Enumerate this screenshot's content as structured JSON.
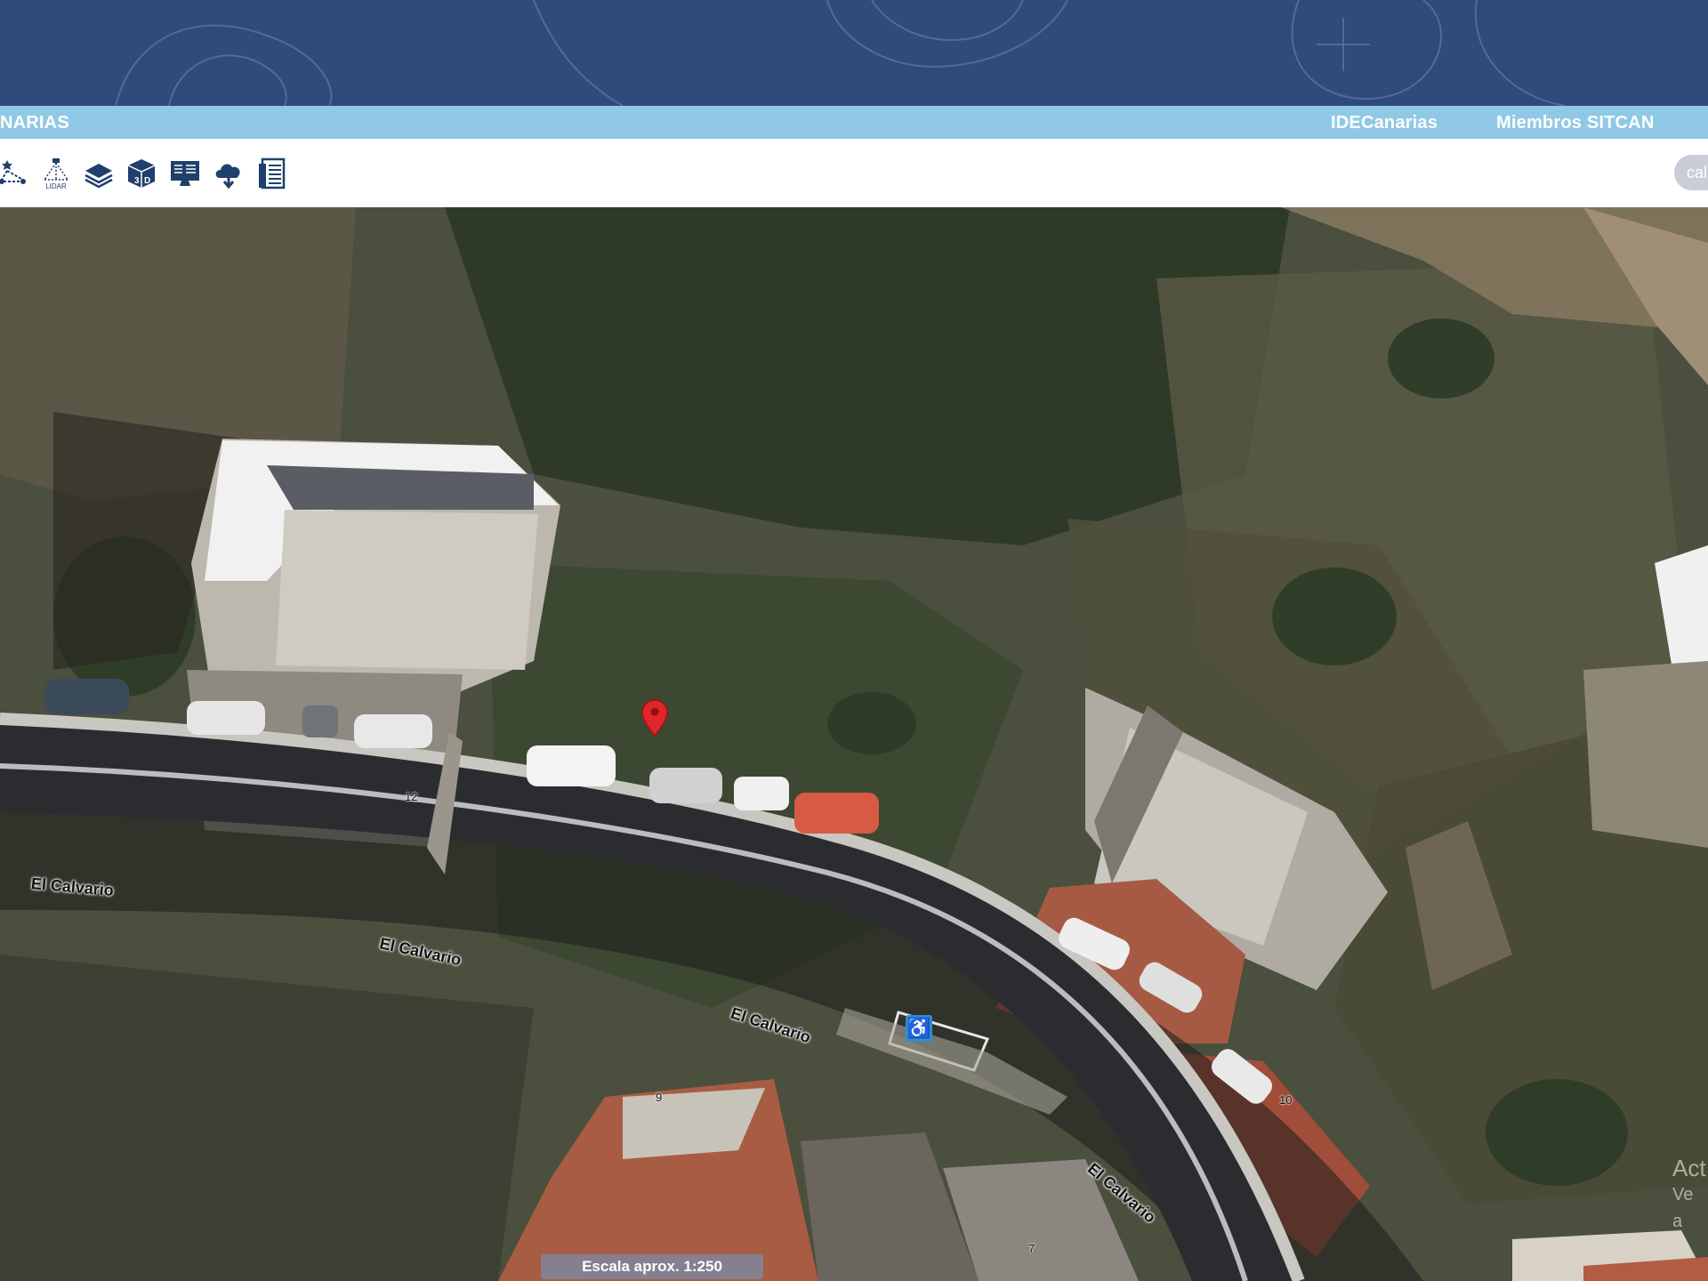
{
  "header": {
    "brand_fragment": "NARIAS",
    "links": [
      "IDECanarias",
      "Miembros SITCAN"
    ]
  },
  "toolbar": {
    "tools": [
      {
        "name": "network-icon"
      },
      {
        "name": "lidar-icon",
        "label": "LIDAR"
      },
      {
        "name": "layers-icon"
      },
      {
        "name": "3d-cube-icon",
        "label": "3D"
      },
      {
        "name": "monitor-icon"
      },
      {
        "name": "cloud-download-icon"
      },
      {
        "name": "document-list-icon"
      }
    ],
    "search_fragment": "cal"
  },
  "map": {
    "street_labels": [
      "El Calvario",
      "El Calvario",
      "El Calvario",
      "El Calvario"
    ],
    "house_numbers": [
      "12",
      "9",
      "10",
      "7"
    ],
    "scale_label": "Escala aprox. 1:250",
    "watermark": {
      "line1": "Act",
      "line2": "Ve a"
    }
  },
  "colors": {
    "banner": "#2e4b7a",
    "navbar": "#8fc9e6",
    "marker": "#e0262a",
    "accessibility": "#2c8fd6"
  }
}
